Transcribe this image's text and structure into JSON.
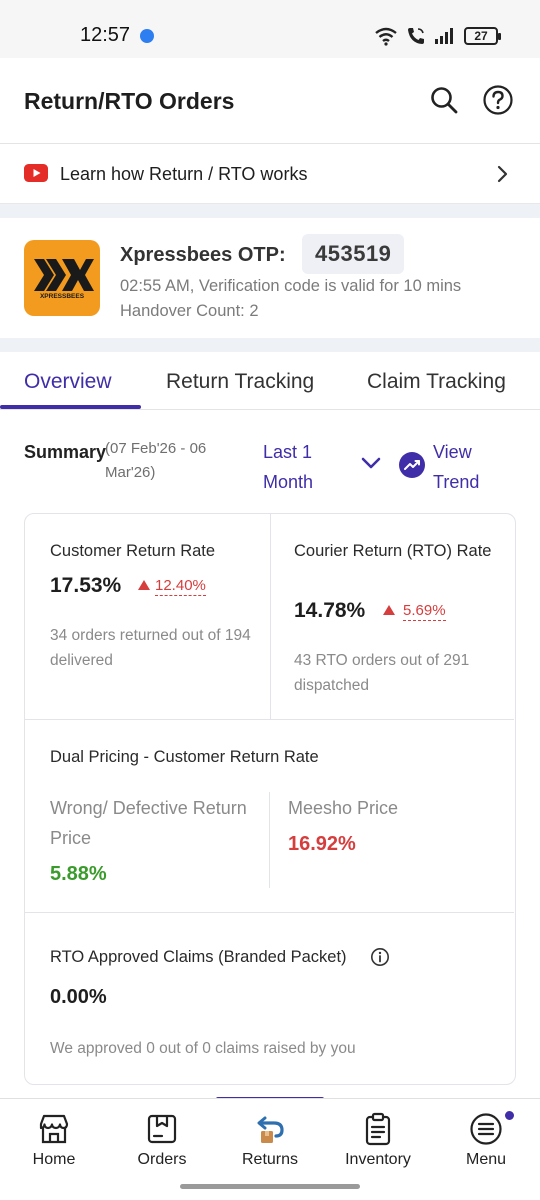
{
  "status": {
    "time": "12:57",
    "battery": "27"
  },
  "header": {
    "title": "Return/RTO Orders"
  },
  "learn": {
    "label": "Learn how Return / RTO works"
  },
  "otp": {
    "logo_text": "XPRESSBEES",
    "title": "Xpressbees OTP:",
    "code": "453519",
    "validity": "02:55 AM, Verification code is valid for 10 mins",
    "handover": "Handover Count: 2"
  },
  "tabs": [
    {
      "label": "Overview"
    },
    {
      "label": "Return Tracking"
    },
    {
      "label": "Claim Tracking"
    }
  ],
  "summary": {
    "label": "Summary",
    "range": "(07 Feb'26 - 06 Mar'26)",
    "period": "Last 1 Month",
    "view_trend": "View Trend"
  },
  "metrics": {
    "customer_return": {
      "title": "Customer Return Rate",
      "value": "17.53%",
      "delta": "12.40%",
      "note": "34 orders returned out of 194 delivered"
    },
    "courier_return": {
      "title": "Courier Return (RTO) Rate",
      "value": "14.78%",
      "delta": "5.69%",
      "note": "43 RTO orders out of 291 dispatched"
    },
    "dual_pricing": {
      "title": "Dual Pricing - Customer Return Rate",
      "wrong_label": "Wrong/ Defective Return Price",
      "wrong_value": "5.88%",
      "meesho_label": "Meesho Price",
      "meesho_value": "16.92%"
    },
    "rto_claims": {
      "title": "RTO Approved Claims (Branded Packet)",
      "value": "0.00%",
      "note": "We approved 0 out of 0 claims raised by you"
    }
  },
  "nav": {
    "home": "Home",
    "orders": "Orders",
    "returns": "Returns",
    "inventory": "Inventory",
    "menu": "Menu"
  },
  "colors": {
    "accent": "#3f2ea8",
    "negative": "#d63d3d",
    "positive": "#3a9b2c",
    "logo_bg": "#f39b1e"
  }
}
